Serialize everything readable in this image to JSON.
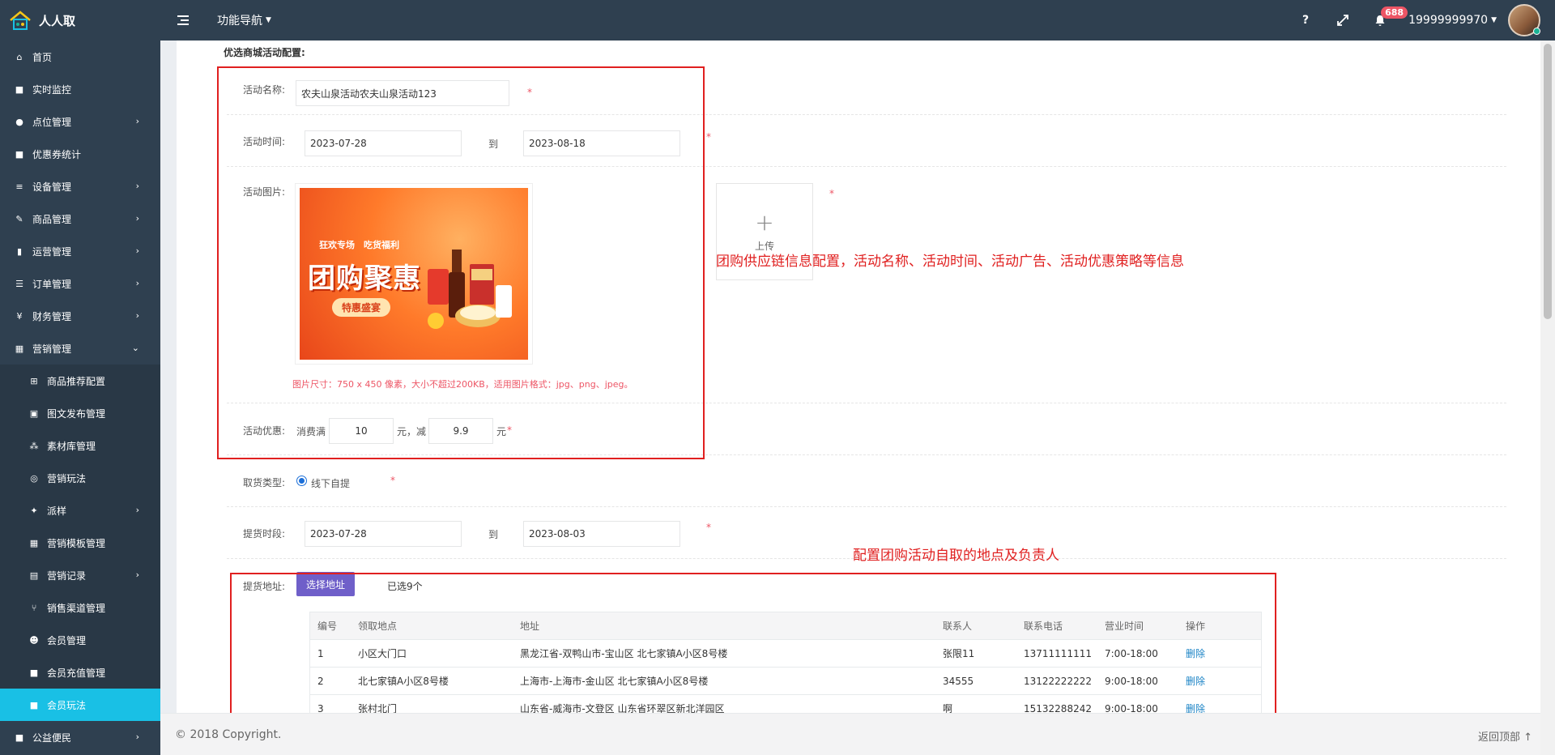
{
  "app": {
    "name": "人人取",
    "nav_label": "功能导航",
    "help": "?",
    "badge": "688",
    "user": "19999999970"
  },
  "sidebar": {
    "items": [
      {
        "label": "首页",
        "icon": "home-icon",
        "glyph": "⌂"
      },
      {
        "label": "实时监控",
        "icon": "video-icon",
        "glyph": "■"
      },
      {
        "label": "点位管理",
        "icon": "map-pin-icon",
        "glyph": "●"
      },
      {
        "label": "优惠券统计",
        "icon": "square-icon",
        "glyph": "■"
      },
      {
        "label": "设备管理",
        "icon": "sort-icon",
        "glyph": "≡"
      },
      {
        "label": "商品管理",
        "icon": "edit-icon",
        "glyph": "✎"
      },
      {
        "label": "运营管理",
        "icon": "bookmark-icon",
        "glyph": "▮"
      },
      {
        "label": "订单管理",
        "icon": "list-icon",
        "glyph": "☰"
      },
      {
        "label": "财务管理",
        "icon": "yen-icon",
        "glyph": "¥"
      },
      {
        "label": "营销管理",
        "icon": "shop-icon",
        "glyph": "▦"
      }
    ],
    "sub_items": [
      {
        "label": "商品推荐配置",
        "icon": "cart-icon",
        "glyph": "⊞"
      },
      {
        "label": "图文发布管理",
        "icon": "image-icon",
        "glyph": "▣"
      },
      {
        "label": "素材库管理",
        "icon": "cubes-icon",
        "glyph": "⁂"
      },
      {
        "label": "营销玩法",
        "icon": "gamepad-icon",
        "glyph": "◎"
      },
      {
        "label": "派样",
        "icon": "gift-icon",
        "glyph": "✦"
      },
      {
        "label": "营销模板管理",
        "icon": "table-icon",
        "glyph": "▦"
      },
      {
        "label": "营销记录",
        "icon": "book-icon",
        "glyph": "▤"
      },
      {
        "label": "销售渠道管理",
        "icon": "share-icon",
        "glyph": "⑂"
      },
      {
        "label": "会员管理",
        "icon": "users-icon",
        "glyph": "☻"
      },
      {
        "label": "会员充值管理",
        "icon": "square-icon",
        "glyph": "■"
      },
      {
        "label": "会员玩法",
        "icon": "square-icon",
        "glyph": "■"
      }
    ],
    "last_item": {
      "label": "公益便民",
      "icon": "square-icon",
      "glyph": "■"
    }
  },
  "form": {
    "section_title": "优选商城活动配置:",
    "name_label": "活动名称:",
    "name_value": "农夫山泉活动农夫山泉活动123",
    "time_label": "活动时间:",
    "time_start": "2023-07-28",
    "time_end": "2023-08-18",
    "to": "到",
    "image_label": "活动图片:",
    "banner_small": "狂欢专场　吃货福利",
    "banner_big": "团购聚惠",
    "banner_tag": "特惠盛宴",
    "upload_plus": "+",
    "upload_label": "上传",
    "image_hint": "图片尺寸：750 x 450 像素，大小不超过200KB，适用图片格式：jpg、png、jpeg。",
    "discount_label": "活动优惠:",
    "discount_prefix": "消费满",
    "discount_full": "10",
    "discount_mid": "元，减",
    "discount_minus": "9.9",
    "discount_suffix": "元",
    "pickup_type_label": "取货类型:",
    "pickup_type_value": "线下自提",
    "pickup_time_label": "提货时段:",
    "pickup_start": "2023-07-28",
    "pickup_end": "2023-08-03",
    "address_label": "提货地址:",
    "choose_address": "选择地址",
    "selected_count": "已选9个",
    "required": "*"
  },
  "notes": {
    "note1": "团购供应链信息配置，活动名称、活动时间、活动广告、活动优惠策略等信息",
    "note2": "配置团购活动自取的地点及负责人"
  },
  "table": {
    "headers": [
      "编号",
      "领取地点",
      "地址",
      "联系人",
      "联系电话",
      "营业时间",
      "操作"
    ],
    "rows": [
      [
        "1",
        "小区大门口",
        "黑龙江省-双鸭山市-宝山区 北七家镇A小区8号楼",
        "张限11",
        "13711111111",
        "7:00-18:00",
        "删除"
      ],
      [
        "2",
        "北七家镇A小区8号楼",
        "上海市-上海市-金山区 北七家镇A小区8号楼",
        "34555",
        "13122222222",
        "9:00-18:00",
        "删除"
      ],
      [
        "3",
        "张村北门",
        "山东省-威海市-文登区 山东省环翠区新北洋园区",
        "啊",
        "15132288242",
        "9:00-18:00",
        "删除"
      ]
    ]
  },
  "footer": {
    "copyright": "© 2018 Copyright.",
    "back_top": "返回顶部 ↑"
  }
}
